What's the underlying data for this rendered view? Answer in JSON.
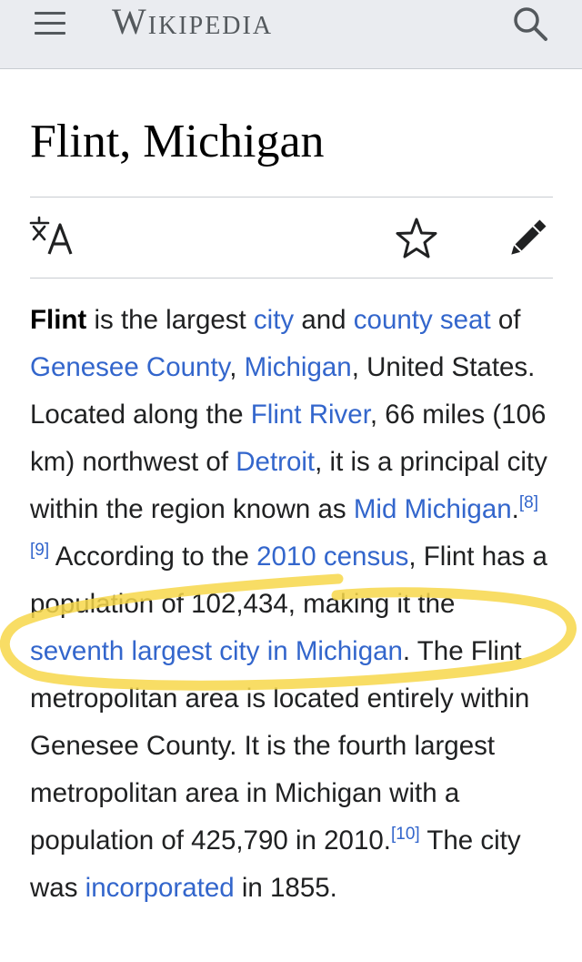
{
  "header": {
    "logo_text": "Wikipedia",
    "background": "#eaecf0"
  },
  "icons": {
    "menu": "hamburger-menu-icon",
    "search": "search-icon",
    "language": "translate-icon",
    "watch": "star-icon",
    "edit": "pencil-icon"
  },
  "article": {
    "title": "Flint, Michigan",
    "lead": {
      "t1": "Flint",
      "t2": " is the largest ",
      "l_city": "city",
      "t3": " and ",
      "l_county_seat": "county seat",
      "t4": " of ",
      "l_genesee": "Genesee County",
      "t5": ", ",
      "l_michigan": "Michigan",
      "t6": ", United States. Located along the ",
      "l_flint_river": "Flint River",
      "t7": ", 66 miles (106 km) northwest of ",
      "l_detroit": "Detroit",
      "t8": ", it is a principal city within the region known as ",
      "l_mid_michigan": "Mid Michigan",
      "t9": ".",
      "ref8": "[8]",
      "ref9": "[9]",
      "t10": " According to the ",
      "l_census": "2010 census",
      "t11": ", Flint has a population of 102,434, making it the ",
      "l_seventh": "seventh largest city in Michigan",
      "t12": ". The Flint metropolitan area is located entirely within Genesee County. It is the fourth largest metropolitan area in Michigan with a population of 425,790 in 2010.",
      "ref10": "[10]",
      "t13": " The city was ",
      "l_incorporated": "incorporated",
      "t14": " in 1855."
    }
  },
  "colors": {
    "link": "#3366cc",
    "highlight_marker": "#f7d74a",
    "text": "#202122"
  }
}
